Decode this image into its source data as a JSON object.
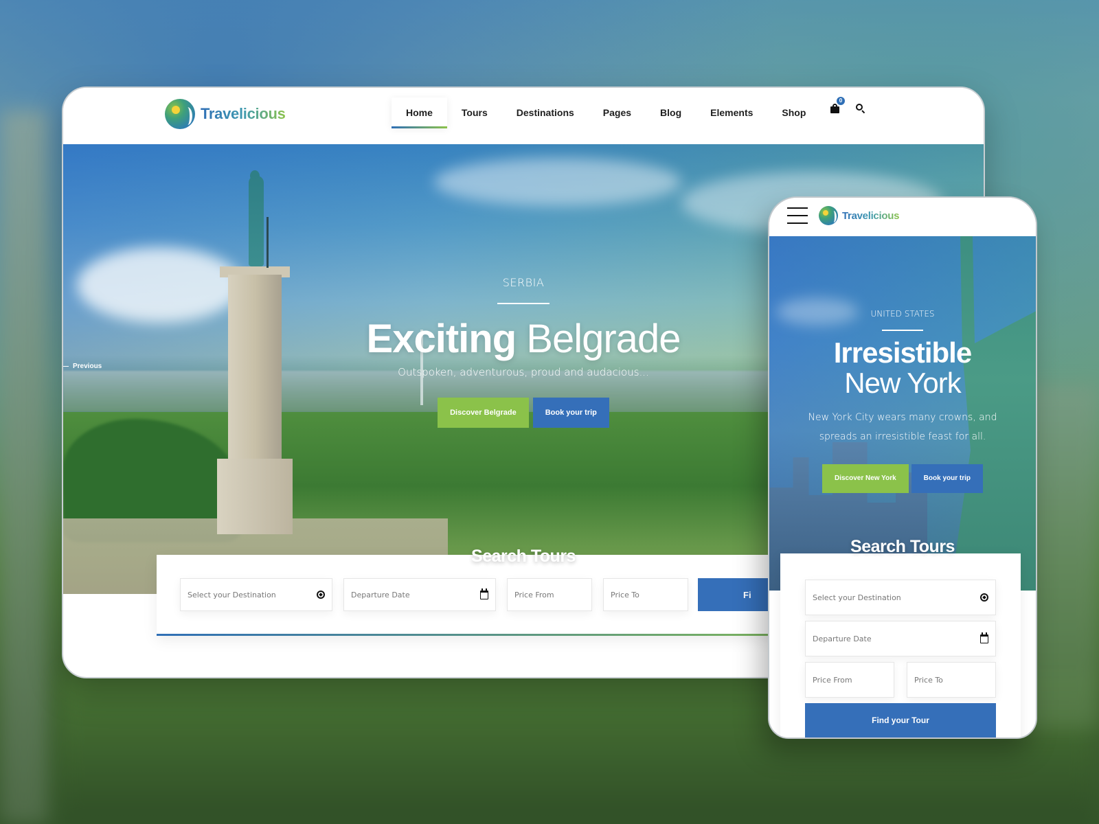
{
  "brand": {
    "name": "Travelicious",
    "colors": {
      "blue": "#356fb9",
      "green": "#8bc24a"
    }
  },
  "desktop": {
    "nav": {
      "items": [
        {
          "label": "Home",
          "active": true
        },
        {
          "label": "Tours",
          "active": false
        },
        {
          "label": "Destinations",
          "active": false
        },
        {
          "label": "Pages",
          "active": false
        },
        {
          "label": "Blog",
          "active": false
        },
        {
          "label": "Elements",
          "active": false
        },
        {
          "label": "Shop",
          "active": false
        }
      ],
      "cart_icon": "shopping-bag-icon",
      "cart_count": "0",
      "search_icon": "search-icon"
    },
    "hero": {
      "prev_label": "Previous",
      "eyebrow": "SERBIA",
      "title_bold": "Exciting",
      "title_light": "Belgrade",
      "subtitle": "Outspoken, adventurous, proud and audacious...",
      "primary_button": "Discover Belgrade",
      "secondary_button": "Book your trip"
    },
    "search": {
      "title": "Search Tours",
      "destination_placeholder": "Select your Destination",
      "destination_icon": "compass-icon",
      "date_placeholder": "Departure Date",
      "date_icon": "calendar-icon",
      "price_from_placeholder": "Price From",
      "price_to_placeholder": "Price To",
      "find_button": "Fi"
    }
  },
  "mobile": {
    "menu_icon": "hamburger-icon",
    "hero": {
      "eyebrow": "UNITED STATES",
      "title_bold": "Irresistible",
      "title_light": "New York",
      "subtitle": "New York City wears many crowns, and spreads an irresistible feast for all.",
      "primary_button": "Discover New York",
      "secondary_button": "Book your trip"
    },
    "search": {
      "title": "Search Tours",
      "destination_placeholder": "Select your Destination",
      "date_placeholder": "Departure Date",
      "price_from_placeholder": "Price From",
      "price_to_placeholder": "Price To",
      "find_button": "Find your Tour"
    }
  }
}
